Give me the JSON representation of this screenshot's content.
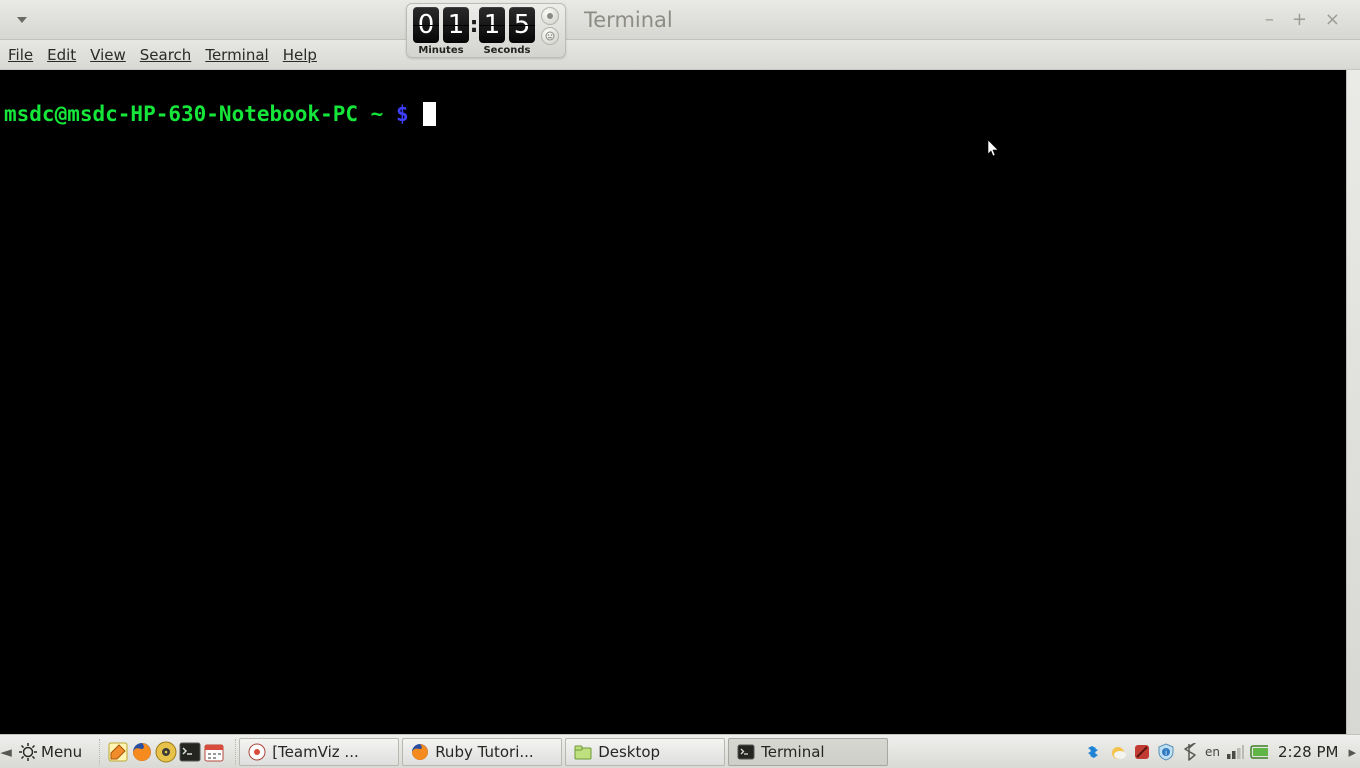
{
  "window": {
    "title": "Terminal",
    "controls": {
      "minimize": "–",
      "maximize": "+",
      "close": "×"
    }
  },
  "timer": {
    "minutes_digits": [
      "0",
      "1"
    ],
    "seconds_digits": [
      "1",
      "5"
    ],
    "minutes_label": "Minutes",
    "seconds_label": "Seconds"
  },
  "menubar": {
    "items": [
      "File",
      "Edit",
      "View",
      "Search",
      "Terminal",
      "Help"
    ]
  },
  "terminal": {
    "prompt_host": "msdc@msdc-HP-630-Notebook-PC",
    "prompt_tilde": "~",
    "prompt_dollar": "$"
  },
  "taskbar": {
    "menu_label": "Menu",
    "tasks": [
      {
        "label": "[TeamViz ...",
        "icon": "teamviz"
      },
      {
        "label": "Ruby Tutori...",
        "icon": "firefox"
      },
      {
        "label": "Desktop",
        "icon": "folder"
      },
      {
        "label": "Terminal",
        "icon": "terminal",
        "active": true
      }
    ],
    "lang": "en",
    "clock": "2:28 PM"
  }
}
